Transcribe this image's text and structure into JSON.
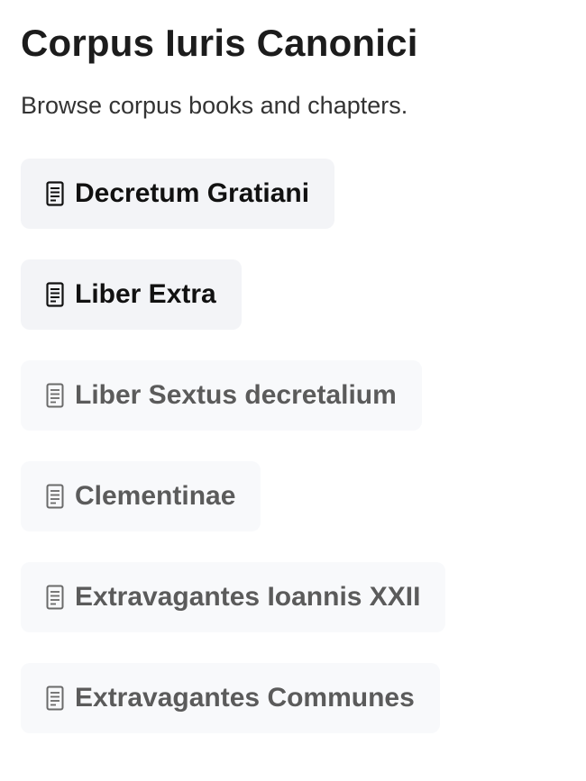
{
  "header": {
    "title": "Corpus Iuris Canonici",
    "subtitle": "Browse corpus books and chapters."
  },
  "books": [
    {
      "label": "Decretum Gratiani",
      "icon": "document-icon",
      "state": "active"
    },
    {
      "label": "Liber Extra",
      "icon": "document-icon",
      "state": "active"
    },
    {
      "label": "Liber Sextus decretalium",
      "icon": "document-icon",
      "state": "muted"
    },
    {
      "label": "Clementinae",
      "icon": "document-icon",
      "state": "muted"
    },
    {
      "label": "Extravagantes Ioannis XXII",
      "icon": "document-icon",
      "state": "muted"
    },
    {
      "label": "Extravagantes Communes",
      "icon": "document-icon",
      "state": "muted"
    }
  ],
  "colors": {
    "active_text": "#111111",
    "muted_text": "#5b5b5b",
    "button_background": "#f6f7f9"
  }
}
